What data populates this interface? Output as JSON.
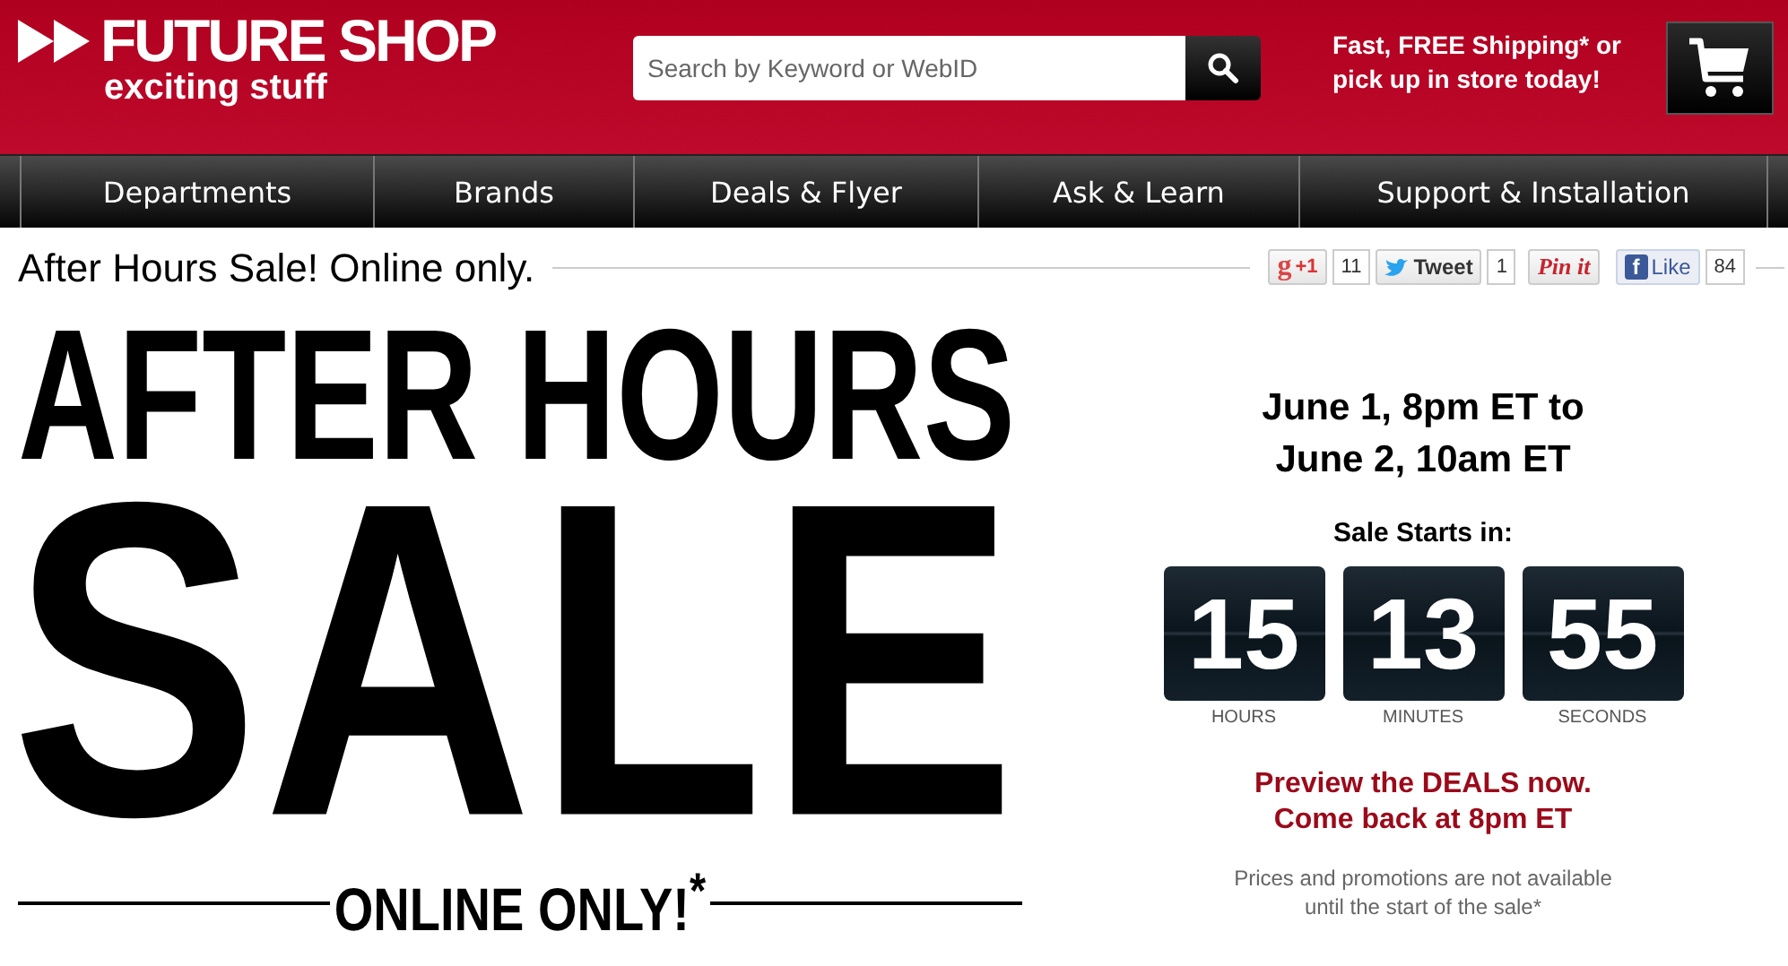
{
  "logo": {
    "name": "FUTURE SHOP",
    "tagline": "exciting stuff"
  },
  "search": {
    "placeholder": "Search by Keyword or WebID"
  },
  "shipping_note": "Fast, FREE Shipping* or pick up in store today!",
  "nav": [
    "Departments",
    "Brands",
    "Deals & Flyer",
    "Ask & Learn",
    "Support & Installation"
  ],
  "page_title": "After Hours Sale! Online only.",
  "social": [
    {
      "kind": "gplus",
      "glyph": "g",
      "label": "+1",
      "count": "11"
    },
    {
      "kind": "tweet",
      "label": "Tweet",
      "count": "1"
    },
    {
      "kind": "pinit",
      "label": "Pin it"
    },
    {
      "kind": "like",
      "glyph": "f",
      "label": "Like",
      "count": "84"
    }
  ],
  "banner": {
    "line1": "AFTER HOURS",
    "line2": "SALE",
    "line3": "ONLINE ONLY!$^{*}$"
  },
  "schedule": "June 1, 8pm ET to\nJune 2, 10am ET",
  "countdown": {
    "title": "Sale Starts in:",
    "units": [
      {
        "value": "15",
        "label": "HOURS"
      },
      {
        "value": "13",
        "label": "MINUTES"
      },
      {
        "value": "55",
        "label": "SECONDS"
      }
    ]
  },
  "preview": "Preview the DEALS now.\nCome back at 8pm ET",
  "disclaimer": "Prices and promotions are not available\nuntil the start of the sale*"
}
